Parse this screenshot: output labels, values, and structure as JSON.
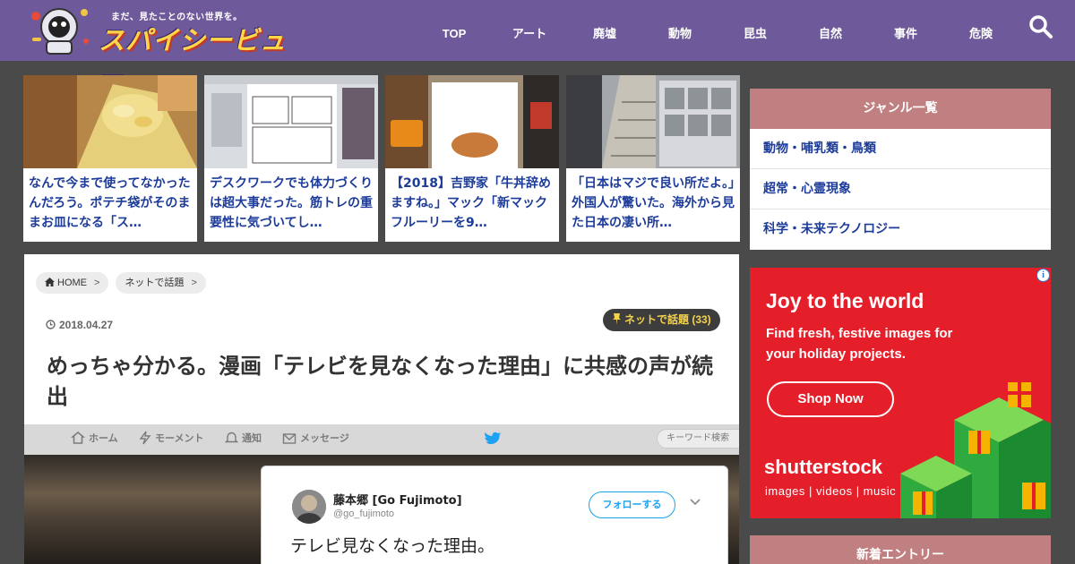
{
  "site": {
    "tagline": "まだ、見たことのない世界を。",
    "title": "スパイシービュー"
  },
  "nav": {
    "items": [
      "TOP",
      "アート",
      "廃墟",
      "動物",
      "昆虫",
      "自然",
      "事件",
      "危険"
    ]
  },
  "featured": [
    {
      "title": "なんで今まで使ってなかったんだろう。ポテチ袋がそのままお皿になる「ス…"
    },
    {
      "title": "デスクワークでも体力づくりは超大事だった。筋トレの重要性に気づいてし…"
    },
    {
      "title": "【2018】吉野家「牛丼辞めますね。」マック「新マックフルーリーを9…"
    },
    {
      "title": "「日本はマジで良い所だよ。」外国人が驚いた。海外から見た日本の凄い所…"
    }
  ],
  "breadcrumb": {
    "home": "HOME",
    "category": "ネットで話題",
    "separator": ">"
  },
  "article": {
    "date": "2018.04.27",
    "category_badge": "ネットで話題 (33)",
    "title": "めっちゃ分かる。漫画「テレビを見なくなった理由」に共感の声が続出"
  },
  "embed": {
    "nav": [
      "ホーム",
      "モーメント",
      "通知",
      "メッセージ"
    ],
    "search_placeholder": "キーワード検索",
    "tweet": {
      "name": "藤本郷 [Go Fujimoto]",
      "handle": "@go_fujimoto",
      "follow_label": "フォローする",
      "text": "テレビ見なくなった理由。"
    }
  },
  "sidebar": {
    "genre_heading": "ジャンル一覧",
    "genres": [
      "動物・哺乳類・鳥類",
      "超常・心霊現象",
      "科学・未来テクノロジー"
    ],
    "new_entries_heading": "新着エントリー"
  },
  "ad": {
    "headline": "Joy to the world",
    "subtext": "Find fresh, festive images for your holiday projects.",
    "button": "Shop Now",
    "brand": "shutterstock",
    "tagline": "images  |  videos  |  music",
    "choice_label": "i"
  },
  "colors": {
    "header": "#6e5a9a",
    "link": "#1d3c9a",
    "widget_head": "#c07f80",
    "ad_red": "#e41f2a",
    "badge_text": "#f4d24a"
  }
}
